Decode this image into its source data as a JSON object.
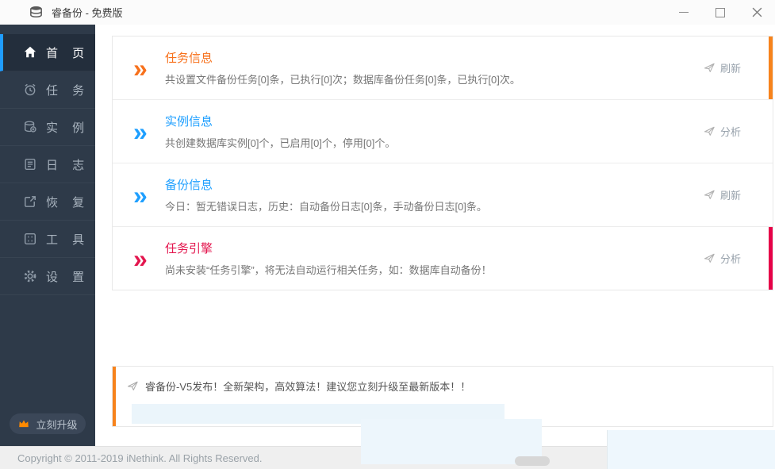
{
  "window": {
    "title": "睿备份 - 免费版",
    "controls": [
      "minimize",
      "maximize",
      "close"
    ]
  },
  "sidebar": {
    "items": [
      {
        "label": "首 页",
        "icon": "home-icon",
        "active": true
      },
      {
        "label": "任 务",
        "icon": "alarm-icon",
        "active": false
      },
      {
        "label": "实 例",
        "icon": "database-icon",
        "active": false
      },
      {
        "label": "日 志",
        "icon": "log-icon",
        "active": false
      },
      {
        "label": "恢 复",
        "icon": "restore-icon",
        "active": false
      },
      {
        "label": "工 具",
        "icon": "tools-icon",
        "active": false
      },
      {
        "label": "设 置",
        "icon": "gear-icon",
        "active": false
      }
    ],
    "upgrade_label": "立刻升级"
  },
  "cards": [
    {
      "title": "任务信息",
      "desc": "共设置文件备份任务[0]条，已执行[0]次；数据库备份任务[0]条，已执行[0]次。",
      "action": "刷新",
      "accent_color": "#f7711c",
      "edge_color": "#f7831c"
    },
    {
      "title": "实例信息",
      "desc": "共创建数据库实例[0]个，已启用[0]个，停用[0]个。",
      "action": "分析",
      "accent_color": "#1e9fff",
      "edge_color": ""
    },
    {
      "title": "备份信息",
      "desc": "今日：暂无错误日志，历史：自动备份日志[0]条，手动备份日志[0]条。",
      "action": "刷新",
      "accent_color": "#1e9fff",
      "edge_color": ""
    },
    {
      "title": "任务引擎",
      "desc": "尚未安装“任务引擎”，将无法自动运行相关任务，如：数据库自动备份！",
      "action": "分析",
      "accent_color": "#e3164e",
      "edge_color": "#e60048"
    }
  ],
  "icons": {
    "chevron": "»"
  },
  "notice": {
    "text": "睿备份-V5发布！全新架构，高效算法！建议您立刻升级至最新版本！！"
  },
  "footer": {
    "copyright": "Copyright © 2011-2019 iNethink. All Rights Reserved."
  },
  "colors": {
    "sidebar_bg": "#2e3a49",
    "sidebar_active_bg": "#232e3c",
    "sidebar_accent": "#1f9dff",
    "orange": "#f7711c",
    "blue": "#1e9fff",
    "red": "#e3164e",
    "edge_red": "#e60048",
    "crown_orange": "#ff8a00"
  }
}
